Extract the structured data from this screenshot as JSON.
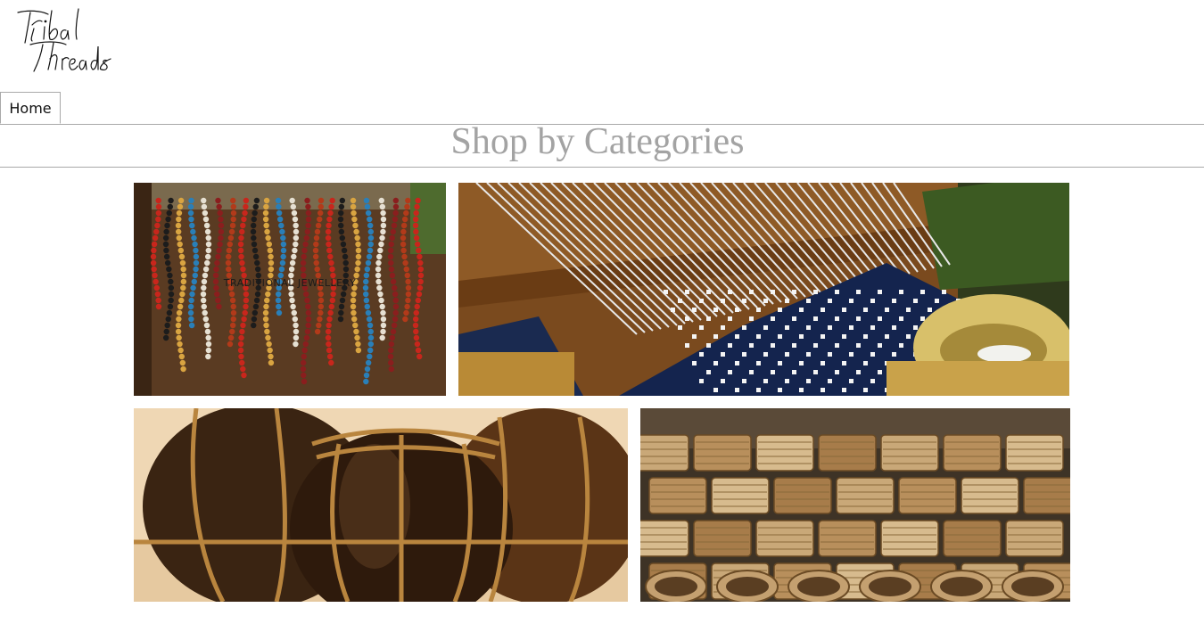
{
  "brand": {
    "logo_text": "Tribal Threads"
  },
  "nav": {
    "home_label": "Home"
  },
  "main": {
    "heading": "Shop by Categories",
    "categories": [
      {
        "name": "TRADITIONAL JEWELLERY",
        "image": "beaded-necklaces"
      },
      {
        "name": "",
        "image": "handloom-weaving"
      },
      {
        "name": "",
        "image": "cane-wrapped-pots"
      },
      {
        "name": "",
        "image": "woven-baskets"
      }
    ]
  },
  "colors": {
    "heading": "#a3a3a3",
    "rule": "#a9a9a9",
    "background": "#ffffff"
  }
}
